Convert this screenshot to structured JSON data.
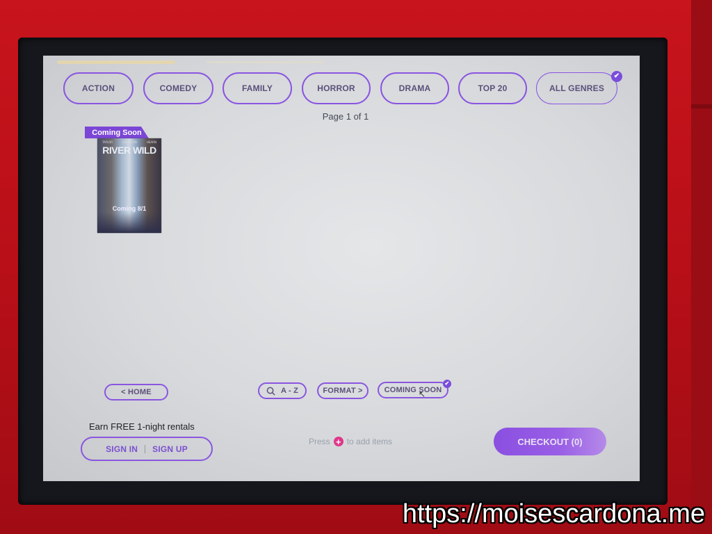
{
  "genres": [
    {
      "label": "ACTION",
      "selected": false
    },
    {
      "label": "COMEDY",
      "selected": false
    },
    {
      "label": "FAMILY",
      "selected": false
    },
    {
      "label": "HORROR",
      "selected": false
    },
    {
      "label": "DRAMA",
      "selected": false
    },
    {
      "label": "TOP 20",
      "selected": false
    },
    {
      "label": "ALL GENRES",
      "selected": true
    }
  ],
  "pagination": {
    "label": "Page 1 of 1"
  },
  "movies": [
    {
      "badge": "Coming Soon",
      "title": "RIVER WILD",
      "availability": "Coming 8/1",
      "credits": [
        "TAYLOR",
        "LEIGHTON",
        "HEARN"
      ]
    }
  ],
  "nav": {
    "home": "< HOME",
    "az": "A - Z",
    "format": "FORMAT >",
    "coming_soon": "COMING SOON",
    "coming_soon_selected": true
  },
  "account": {
    "promo": "Earn FREE 1-night rentals",
    "sign_in": "SIGN IN",
    "sign_up": "SIGN UP"
  },
  "cart": {
    "hint_before": "Press",
    "hint_after": "to add items",
    "checkout": "CHECKOUT (0)"
  },
  "icons": {
    "check": "✔",
    "plus": "+",
    "search": "search-icon"
  },
  "colors": {
    "accent": "#8a55e0",
    "pink": "#e0368a",
    "kiosk_red": "#c8141c"
  },
  "watermark": "https://moisescardona.me"
}
